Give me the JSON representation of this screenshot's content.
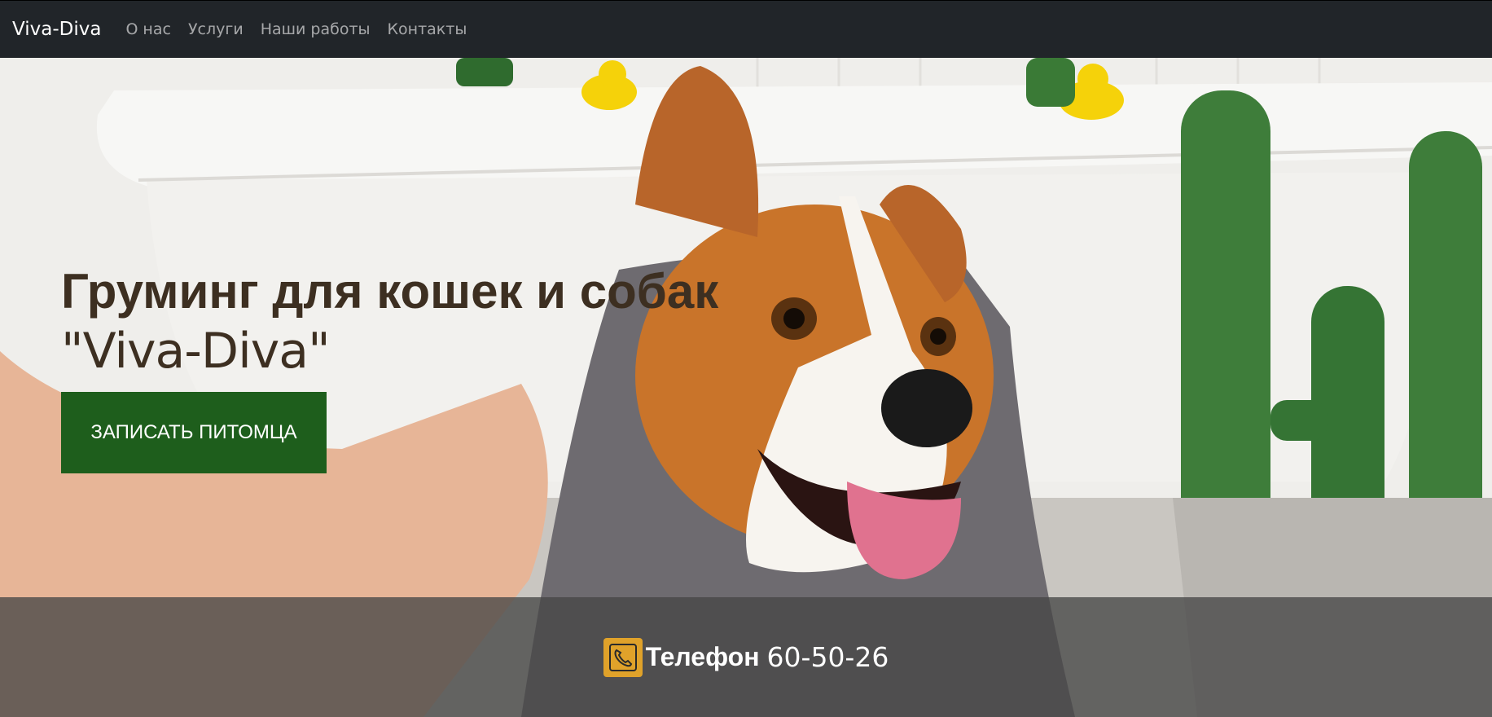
{
  "navbar": {
    "brand": "Viva-Diva",
    "links": [
      {
        "label": "О нас"
      },
      {
        "label": "Услуги"
      },
      {
        "label": "Наши работы"
      },
      {
        "label": "Контакты"
      }
    ]
  },
  "hero": {
    "title": "Груминг для кошек и собак",
    "subtitle": "\"Viva-Diva\"",
    "cta_label": "ЗАПИСАТЬ ПИТОМЦА"
  },
  "contact": {
    "phone_icon": "phone-icon",
    "phone_label": "Телефон",
    "phone_number": "60-50-26"
  },
  "colors": {
    "navbar_bg": "#212529",
    "title_color": "#3d2f21",
    "cta_bg": "#1e5e1c",
    "phone_icon_bg": "#e0a22a"
  }
}
